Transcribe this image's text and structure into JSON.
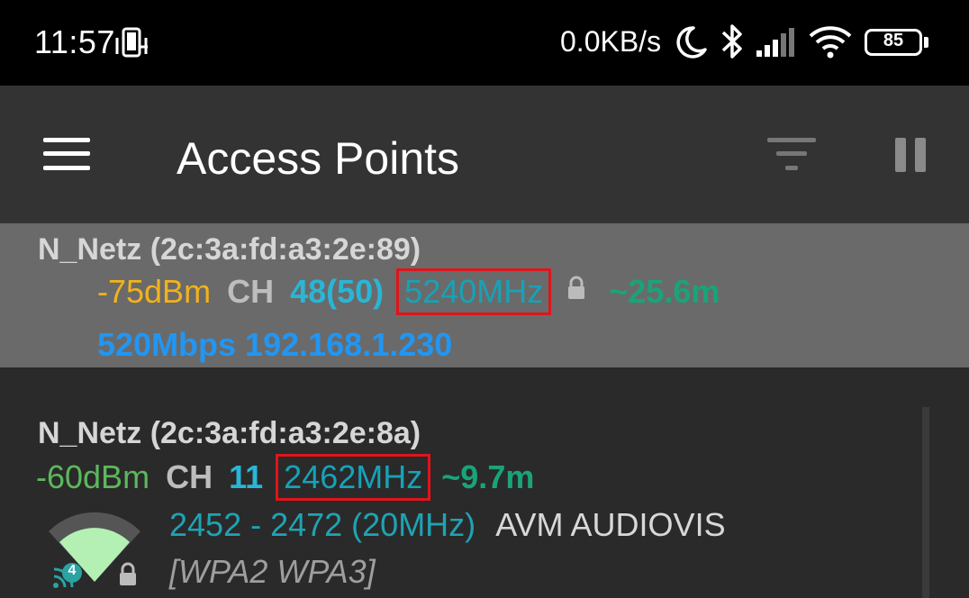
{
  "status_bar": {
    "time": "11:57",
    "network_rate": "0.0KB/s",
    "battery_level": "85"
  },
  "toolbar": {
    "title": "Access Points"
  },
  "access_points": [
    {
      "name": "N_Netz (2c:3a:fd:a3:2e:89)",
      "level": "-75dBm",
      "channel_label": "CH",
      "channel": "48(50)",
      "frequency": "5240MHz",
      "distance": "~25.6m",
      "speed_ip": "520Mbps 192.168.1.230",
      "locked": true,
      "selected": true
    },
    {
      "name": "N_Netz (2c:3a:fd:a3:2e:8a)",
      "level": "-60dBm",
      "channel_label": "CH",
      "channel": "11",
      "frequency": "2462MHz",
      "distance": "~9.7m",
      "range": "2452 - 2472 (20MHz)",
      "vendor": "AVM AUDIOVIS",
      "security": "[WPA2 WPA3]",
      "wifi_standard": "4",
      "locked": true,
      "selected": false
    }
  ],
  "colors": {
    "status_bar_bg": "#000000",
    "toolbar_bg": "#333333",
    "selected_row_bg": "#6a6a6a",
    "list_bg": "#2a2a2a",
    "level_weak": "#f2b21b",
    "level_good": "#5cb85c",
    "channel": "#29b6d6",
    "frequency": "#17a2b8",
    "distance": "#1aa37a",
    "speed": "#2196f3",
    "highlight_box": "#e0141a"
  },
  "icons": {
    "status_left": "screen-mirror-icon",
    "moon": "do-not-disturb-icon",
    "bluetooth": "bluetooth-icon",
    "signal": "cell-signal-icon",
    "wifi": "wifi-icon",
    "battery": "battery-icon",
    "menu": "hamburger-menu-icon",
    "filter": "filter-icon",
    "pause": "pause-icon",
    "lock": "lock-icon",
    "wifi_strength": "wifi-strength-icon",
    "wifi_standard": "wifi-4-badge-icon"
  }
}
